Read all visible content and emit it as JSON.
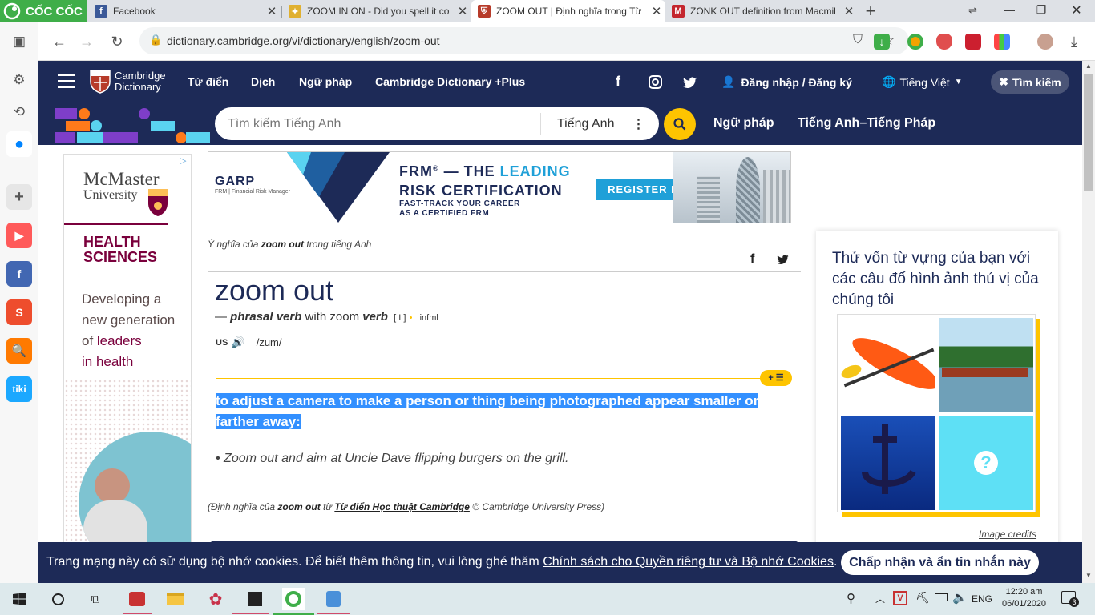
{
  "browser": {
    "brand": "CỐC CỐC",
    "tabs": [
      {
        "title": "Facebook",
        "fav_color": "#3b5998",
        "fav_glyph": "f"
      },
      {
        "title": "ZOOM IN ON - Did you spell it co",
        "fav_color": "#e0b030",
        "fav_glyph": "✦"
      },
      {
        "title": "ZOOM OUT | Định nghĩa trong Từ",
        "fav_color": "#b73b2a",
        "fav_glyph": "⛨"
      },
      {
        "title": "ZONK OUT definition from Macmil",
        "fav_color": "#c4262e",
        "fav_glyph": "M"
      }
    ],
    "new_tab_label": "+",
    "url": "dictionary.cambridge.org/vi/dictionary/english/zoom-out",
    "window_controls": {
      "minimize": "—",
      "maximize": "❐",
      "close": "✕"
    }
  },
  "sidebar_apps": [
    {
      "name": "youtube",
      "color": "#ff5a5a",
      "glyph": "▶"
    },
    {
      "name": "facebook",
      "color": "#4267b2",
      "glyph": "f"
    },
    {
      "name": "shopee",
      "color": "#ee4d2d",
      "glyph": "S"
    },
    {
      "name": "search",
      "color": "#ff7a00",
      "glyph": "🔍"
    },
    {
      "name": "tiki",
      "color": "#1ba8ff",
      "glyph": "tiki"
    }
  ],
  "cambridge": {
    "logo_line1": "Cambridge",
    "logo_line2": "Dictionary",
    "nav": [
      "Từ điển",
      "Dịch",
      "Ngữ pháp",
      "Cambridge Dictionary +Plus"
    ],
    "login": "Đăng nhập / Đăng ký",
    "language": "Tiếng Việt",
    "search_button": "Tìm kiếm",
    "search_placeholder": "Tìm kiếm Tiếng Anh",
    "search_lang": "Tiếng Anh",
    "subnav": [
      "Ngữ pháp",
      "Tiếng Anh–Tiếng Pháp"
    ]
  },
  "ad_left": {
    "brand_line1": "McMaster",
    "brand_line2": "University",
    "heading_line1": "HEALTH",
    "heading_line2": "SCIENCES",
    "text_line1": "Developing a",
    "text_line2": "new generation",
    "text_line3_a": "of ",
    "text_line3_b": "leaders",
    "text_line4": "in health"
  },
  "ad_top": {
    "brand": "GARP",
    "brand_sub": "FRM | Financial Risk Manager",
    "line1_a": "FRM",
    "line1_sup": "®",
    "line1_b": " — THE ",
    "line1_c": "LEADING",
    "line2": "RISK CERTIFICATION",
    "line3": "FAST-TRACK YOUR CAREER",
    "line4": "AS A CERTIFIED FRM",
    "cta": "REGISTER NOW"
  },
  "entry": {
    "meaning_prefix": "Ý nghĩa của ",
    "meaning_word": "zoom out",
    "meaning_suffix": " trong tiếng Anh",
    "headword": "zoom out",
    "dash": "— ",
    "pos": "phrasal verb",
    "with_text": " with zoom ",
    "verb": "verb",
    "gram": "[ I ]",
    "dot": "•",
    "register": "infml",
    "region": "US",
    "pron": "/zum/",
    "definition": "to adjust a camera to make a person or thing being photographed appear smaller or farther away:",
    "example": "• Zoom out and aim at Uncle Dave flipping burgers on the grill.",
    "source_prefix": "(Định nghĩa của ",
    "source_word": "zoom out",
    "source_mid": " từ ",
    "source_link": "Từ điển Học thuật Cambridge",
    "source_suffix": " © Cambridge University Press)",
    "plus_badge": "+ ☰"
  },
  "quiz": {
    "title": "Thử vốn từ vựng của bạn với các câu đố hình ảnh thú vị của chúng tôi",
    "credits": "Image credits",
    "mystery_glyph": "?"
  },
  "cookie": {
    "text": "Trang mạng này có sử dụng bộ nhớ cookies. Để biết thêm thông tin, vui lòng ghé thăm ",
    "link": "Chính sách cho Quyền riêng tư và Bộ nhớ Cookies",
    "end": ".",
    "button": "Chấp nhận và ẩn tin nhắn này"
  },
  "taskbar": {
    "lang": "ENG",
    "time": "12:20 am",
    "date": "06/01/2020",
    "notif": "3"
  },
  "colors": {
    "cambridge_navy": "#1d2a57",
    "accent_yellow": "#fec400",
    "highlight_blue": "#3390ff",
    "mcmaster_maroon": "#7a003c"
  }
}
